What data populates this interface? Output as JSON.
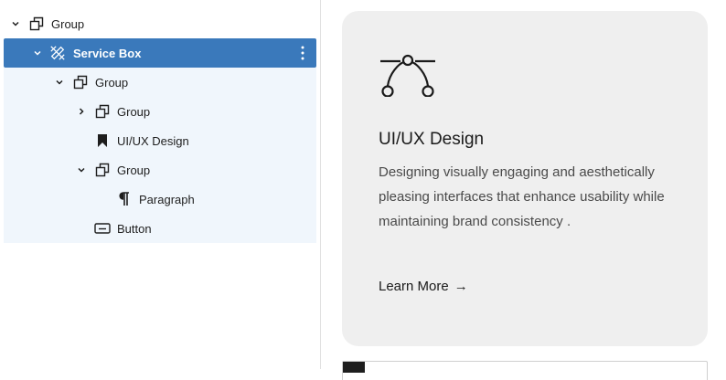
{
  "list_view": {
    "items": [
      {
        "label": "Group",
        "icon": "group-icon",
        "chevron": "chevron-down-icon",
        "state": "normal"
      },
      {
        "label": "Service Box",
        "icon": "pattern-icon",
        "chevron": "chevron-down-icon",
        "state": "selected"
      },
      {
        "label": "Group",
        "icon": "group-icon",
        "chevron": "chevron-down-icon",
        "state": "child"
      },
      {
        "label": "Group",
        "icon": "group-icon",
        "chevron": "chevron-right-icon",
        "state": "child"
      },
      {
        "label": "UI/UX Design",
        "icon": "heading-icon",
        "chevron": "",
        "state": "child"
      },
      {
        "label": "Group",
        "icon": "group-icon",
        "chevron": "chevron-down-icon",
        "state": "child"
      },
      {
        "label": "Paragraph",
        "icon": "paragraph-icon",
        "chevron": "",
        "state": "child"
      },
      {
        "label": "Button",
        "icon": "button-icon",
        "chevron": "",
        "state": "child"
      }
    ]
  },
  "card": {
    "icon": "bezier-curve-icon",
    "title": "UI/UX Design",
    "description": "Designing visually engaging and aesthetically pleasing interfaces that enhance usability while maintaining brand consistency .",
    "link_label": "Learn More",
    "link_arrow": "→"
  },
  "colors": {
    "selected_bg": "#3a79bb",
    "child_bg": "#f0f6fc",
    "card_bg": "#efefef"
  }
}
